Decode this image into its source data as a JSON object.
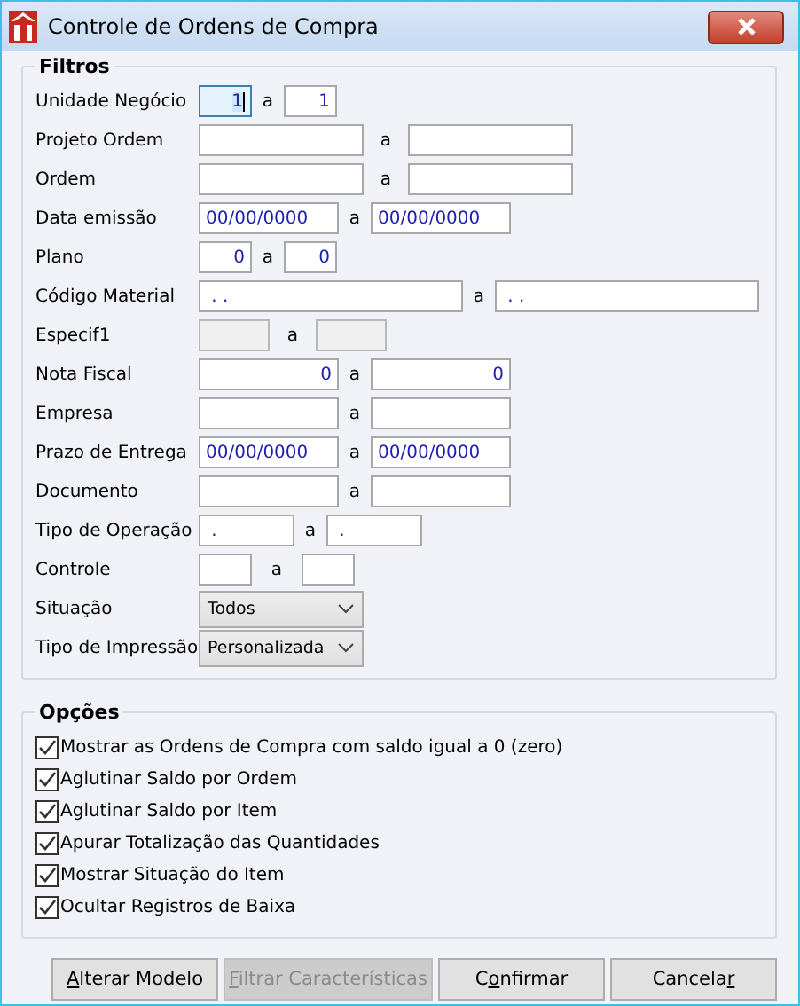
{
  "window": {
    "title": "Controle de Ordens de Compra"
  },
  "filters": {
    "legend": "Filtros",
    "rows": [
      {
        "label": "Unidade Negócio",
        "kind": "narrow",
        "separator": "a",
        "from": {
          "kind": "number",
          "value": "1",
          "focused": true,
          "disabled": false
        },
        "to": {
          "kind": "number",
          "value": "1",
          "focused": false,
          "disabled": false
        }
      },
      {
        "label": "Projeto Ordem",
        "kind": "medium",
        "separator": "a",
        "from": {
          "kind": "text",
          "focused": false,
          "disabled": false
        },
        "to": {
          "kind": "text",
          "focused": false,
          "disabled": false
        }
      },
      {
        "label": "Ordem",
        "kind": "medium",
        "separator": "a",
        "from": {
          "kind": "text",
          "focused": false,
          "disabled": false
        },
        "to": {
          "kind": "text",
          "focused": false,
          "disabled": false
        }
      },
      {
        "label": "Data emissão",
        "kind": "date",
        "separator": "a",
        "from": {
          "kind": "text",
          "value": "00/00/0000",
          "focused": false,
          "disabled": false
        },
        "to": {
          "kind": "text",
          "value": "00/00/0000",
          "focused": false,
          "disabled": false
        }
      },
      {
        "label": "Plano",
        "kind": "narrow",
        "separator": "a",
        "from": {
          "kind": "number",
          "value": "0",
          "focused": false,
          "disabled": false
        },
        "to": {
          "kind": "number",
          "value": "0",
          "focused": false,
          "disabled": false
        }
      },
      {
        "label": "Código Material",
        "kind": "wide",
        "separator": "a",
        "from": {
          "kind": "text",
          "value": " . .",
          "focused": false,
          "disabled": false
        },
        "to": {
          "kind": "text",
          "value": " . .",
          "focused": false,
          "disabled": false
        }
      },
      {
        "label": "Especif1",
        "kind": "short",
        "separator": "a",
        "from": {
          "kind": "text",
          "focused": false,
          "disabled": true
        },
        "to": {
          "kind": "text",
          "focused": false,
          "disabled": true
        }
      },
      {
        "label": "Nota Fiscal",
        "kind": "date",
        "separator": "a",
        "from": {
          "kind": "number",
          "value": "0",
          "focused": false,
          "disabled": false
        },
        "to": {
          "kind": "number",
          "value": "0",
          "focused": false,
          "disabled": false
        }
      },
      {
        "label": "Empresa",
        "kind": "date",
        "separator": "a",
        "from": {
          "kind": "text",
          "focused": false,
          "disabled": false
        },
        "to": {
          "kind": "text",
          "focused": false,
          "disabled": false
        }
      },
      {
        "label": "Prazo de Entrega",
        "kind": "date",
        "separator": "a",
        "from": {
          "kind": "text",
          "value": "00/00/0000",
          "focused": false,
          "disabled": false
        },
        "to": {
          "kind": "text",
          "value": "00/00/0000",
          "focused": false,
          "disabled": false
        }
      },
      {
        "label": "Documento",
        "kind": "date",
        "separator": "a",
        "from": {
          "kind": "text",
          "focused": false,
          "disabled": false
        },
        "to": {
          "kind": "text",
          "focused": false,
          "disabled": false
        }
      },
      {
        "label": "Tipo de Operação",
        "kind": "operation",
        "separator": "a",
        "from": {
          "kind": "text",
          "value": " .",
          "focused": false,
          "disabled": false
        },
        "to": {
          "kind": "text",
          "value": " .",
          "focused": false,
          "disabled": false
        }
      },
      {
        "label": "Controle",
        "kind": "control",
        "separator": "a",
        "from": {
          "kind": "text",
          "focused": false,
          "disabled": false
        },
        "to": {
          "kind": "text",
          "focused": false,
          "disabled": false
        }
      },
      {
        "label": "Situação",
        "kind": "select",
        "value": "Todos"
      },
      {
        "label": "Tipo de Impressão",
        "kind": "select",
        "value": "Personalizada"
      }
    ]
  },
  "options": {
    "legend": "Opções",
    "items": [
      {
        "label": "Mostrar as Ordens de Compra com saldo igual a 0 (zero)",
        "checked": true
      },
      {
        "label": "Aglutinar Saldo por Ordem",
        "checked": true
      },
      {
        "label": "Aglutinar Saldo por Item",
        "checked": true
      },
      {
        "label": "Apurar Totalização das Quantidades",
        "checked": true
      },
      {
        "label": "Mostrar Situação do Item",
        "checked": true
      },
      {
        "label": "Ocultar Registros de Baixa",
        "checked": true
      }
    ]
  },
  "buttons": [
    {
      "key": "A",
      "post": "lterar Modelo",
      "disabled": false
    },
    {
      "key": "F",
      "post": "iltrar Características",
      "disabled": true
    },
    {
      "pre": "C",
      "key": "o",
      "post": "nfirmar",
      "disabled": false
    },
    {
      "pre": "Cancela",
      "key": "r",
      "disabled": false
    }
  ]
}
